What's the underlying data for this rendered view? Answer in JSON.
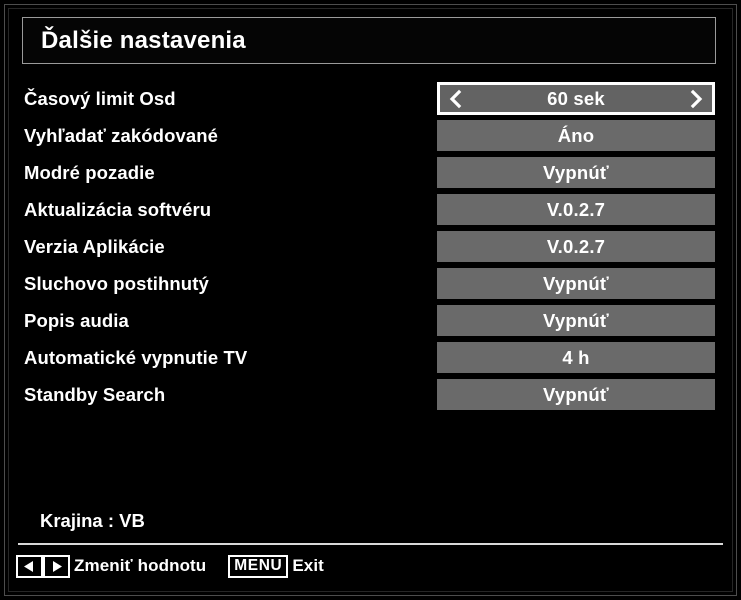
{
  "menu": {
    "title": "Ďalšie nastavenia",
    "rows": [
      {
        "label": "Časový limit Osd",
        "value": "60 sek",
        "selected": true
      },
      {
        "label": "Vyhľadať zakódované",
        "value": "Áno",
        "selected": false
      },
      {
        "label": "Modré pozadie",
        "value": "Vypnúť",
        "selected": false
      },
      {
        "label": "Aktualizácia softvéru",
        "value": "V.0.2.7",
        "selected": false
      },
      {
        "label": "Verzia Aplikácie",
        "value": "V.0.2.7",
        "selected": false
      },
      {
        "label": "Sluchovo postihnutý",
        "value": "Vypnúť",
        "selected": false
      },
      {
        "label": "Popis audia",
        "value": "Vypnúť",
        "selected": false
      },
      {
        "label": "Automatické vypnutie TV",
        "value": "4 h",
        "selected": false
      },
      {
        "label": "Standby Search",
        "value": "Vypnúť",
        "selected": false
      }
    ],
    "country_line": "Krajina : VB"
  },
  "footer": {
    "change_value_hint": "Zmeniť hodnotu",
    "menu_key_label": "MENU",
    "exit_hint": "Exit"
  },
  "colors": {
    "background": "#000000",
    "value_box": "#6a6a6a",
    "selection_border": "#ffffff",
    "text": "#ffffff",
    "frame": "#9a9a9a"
  }
}
